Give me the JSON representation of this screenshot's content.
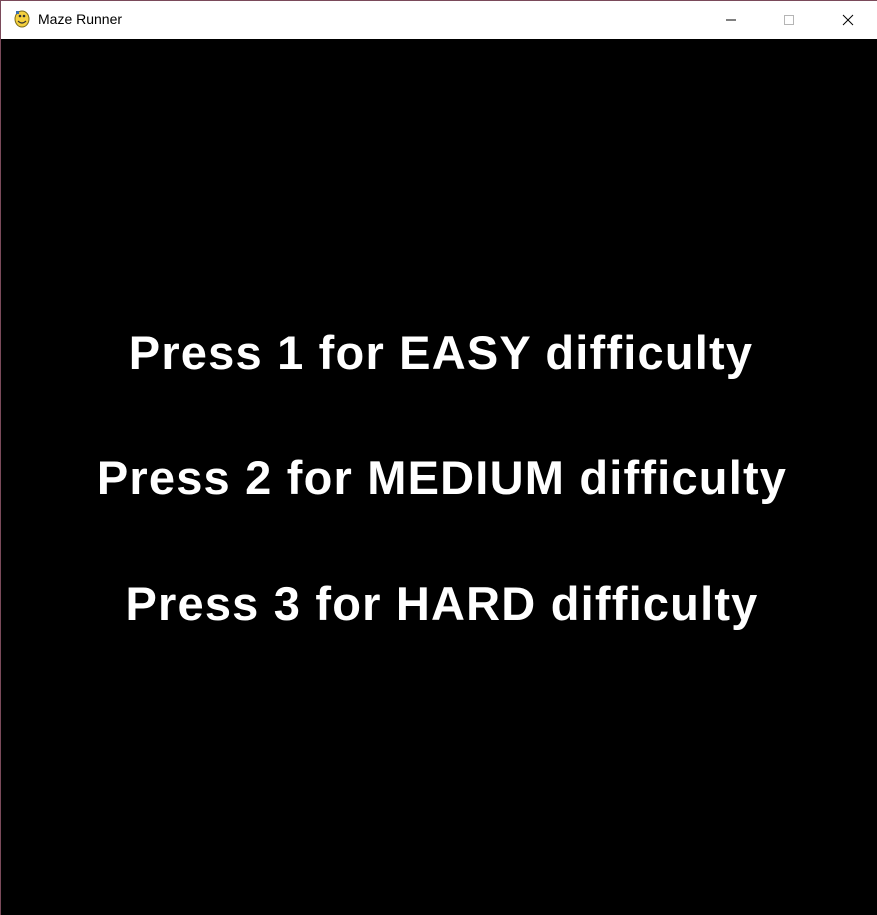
{
  "window": {
    "title": "Maze Runner",
    "app_icon": "python-snake-icon",
    "controls": {
      "minimize_icon": "minimize-icon",
      "maximize_icon": "maximize-icon",
      "close_icon": "close-icon"
    }
  },
  "menu": {
    "lines": [
      "Press 1 for EASY difficulty",
      "Press 2 for MEDIUM difficulty",
      "Press 3 for HARD difficulty"
    ]
  },
  "colors": {
    "background": "#000000",
    "text": "#ffffff",
    "titlebar": "#ffffff"
  }
}
